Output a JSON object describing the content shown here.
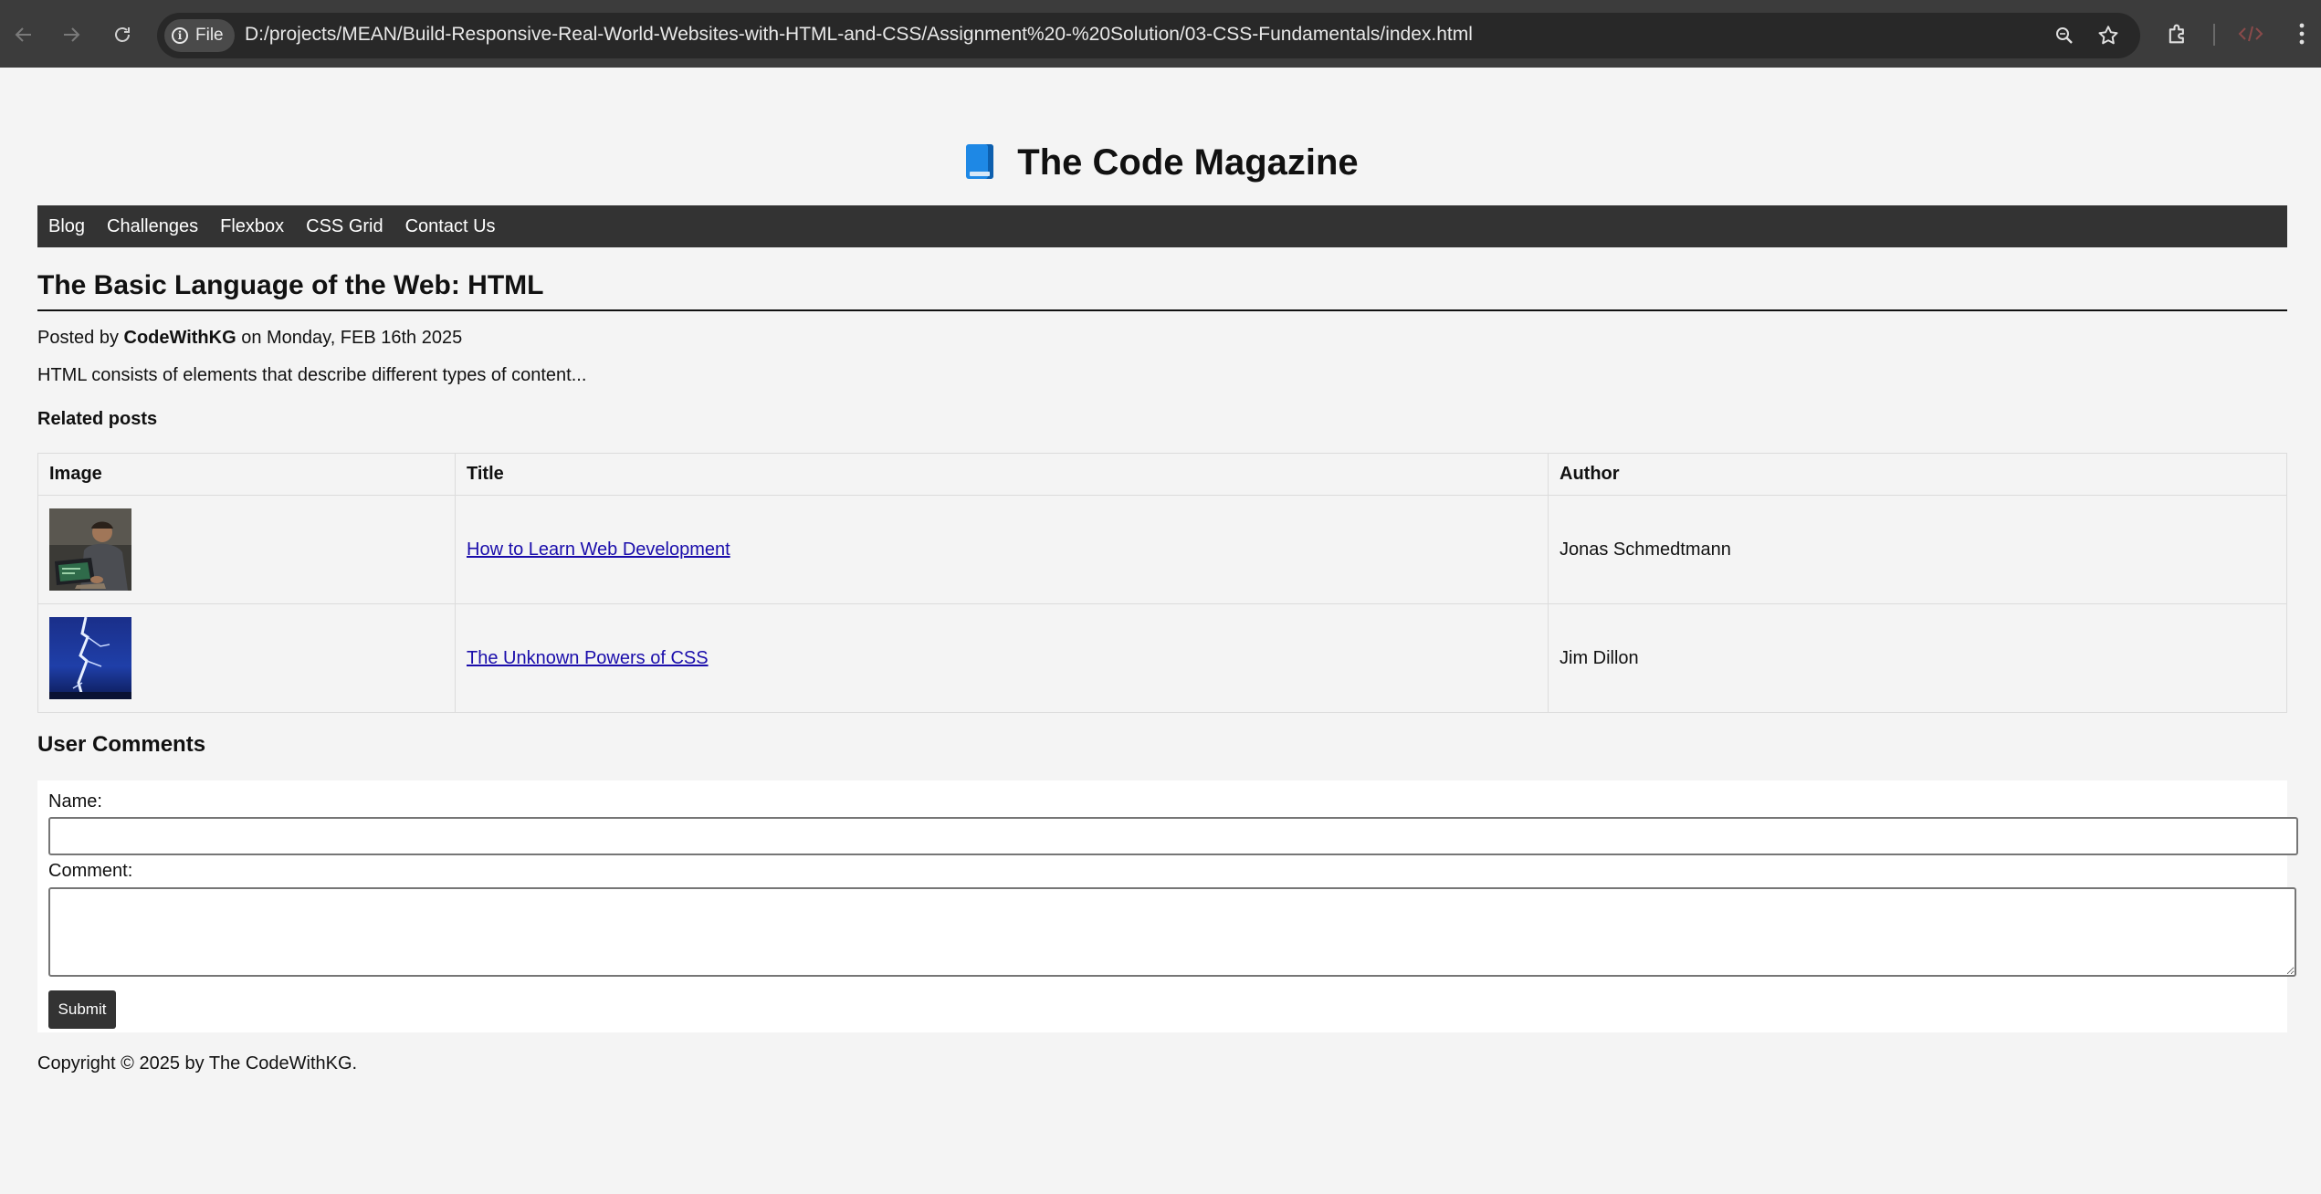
{
  "browser": {
    "site_chip_label": "File",
    "url": "D:/projects/MEAN/Build-Responsive-Real-World-Websites-with-HTML-and-CSS/Assignment%20-%20Solution/03-CSS-Fundamentals/index.html",
    "icons": [
      "back-arrow-icon",
      "forward-arrow-icon",
      "reload-icon",
      "info-icon",
      "zoom-icon",
      "star-icon",
      "extensions-icon",
      "devtools-icon",
      "more-icon"
    ]
  },
  "site": {
    "title": "The Code Magazine",
    "logo_icon": "blue-book-icon"
  },
  "nav": {
    "items": [
      "Blog",
      "Challenges",
      "Flexbox",
      "CSS Grid",
      "Contact Us"
    ]
  },
  "post": {
    "title": "The Basic Language of the Web: HTML",
    "meta_prefix": "Posted by",
    "author": "CodeWithKG",
    "meta_date": "on Monday, FEB 16th 2025",
    "excerpt": "HTML consists of elements that describe different types of content..."
  },
  "related": {
    "heading": "Related posts",
    "columns": [
      "Image",
      "Title",
      "Author"
    ],
    "rows": [
      {
        "image": "person-coding-laptop-photo",
        "title": "How to Learn Web Development",
        "author": "Jonas Schmedtmann"
      },
      {
        "image": "lightning-bolt-photo",
        "title": "The Unknown Powers of CSS",
        "author": "Jim Dillon"
      }
    ]
  },
  "comments": {
    "heading": "User Comments",
    "name_label": "Name:",
    "name_value": "",
    "comment_label": "Comment:",
    "comment_value": "",
    "submit_label": "Submit"
  },
  "footer": {
    "text": "Copyright © 2025 by The CodeWithKG."
  },
  "colors": {
    "page_bg": "#f4f4f4",
    "nav_bg": "#333333",
    "link": "#1a0dab",
    "browser_bar": "#3c3c3c"
  }
}
